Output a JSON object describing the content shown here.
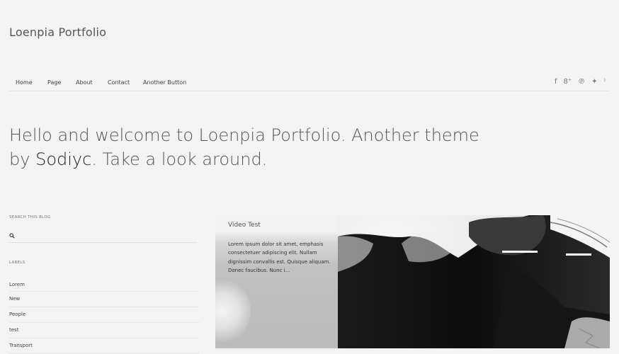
{
  "site": {
    "title": "Loenpia Portfolio"
  },
  "nav": {
    "items": [
      "Home",
      "Page",
      "About",
      "Contact",
      "Another Button"
    ]
  },
  "social": [
    {
      "icon": "facebook-icon",
      "glyph": "f"
    },
    {
      "icon": "google-plus-icon",
      "glyph": "8⁺"
    },
    {
      "icon": "pinterest-icon",
      "glyph": "℗"
    },
    {
      "icon": "twitter-icon",
      "glyph": "✦"
    },
    {
      "icon": "rss-icon",
      "glyph": "⁾"
    }
  ],
  "hero": {
    "text_before": "Hello and welcome to Loenpia Portfolio. Another theme by",
    "author": "Sodiyc",
    "text_after": ". Take a look around."
  },
  "sidebar": {
    "search_heading": "SEARCH THIS BLOG",
    "labels_heading": "LABELS",
    "labels": [
      "Lorem",
      "New",
      "People",
      "test",
      "Transport"
    ]
  },
  "post": {
    "title": "Video Test",
    "excerpt": "Lorem ipsum dolor sit amet, emphasis consectetuer adipiscing elit. Nullam dignissim convallis est. Quisque aliquam. Donec faucibus. Nunc i..."
  }
}
